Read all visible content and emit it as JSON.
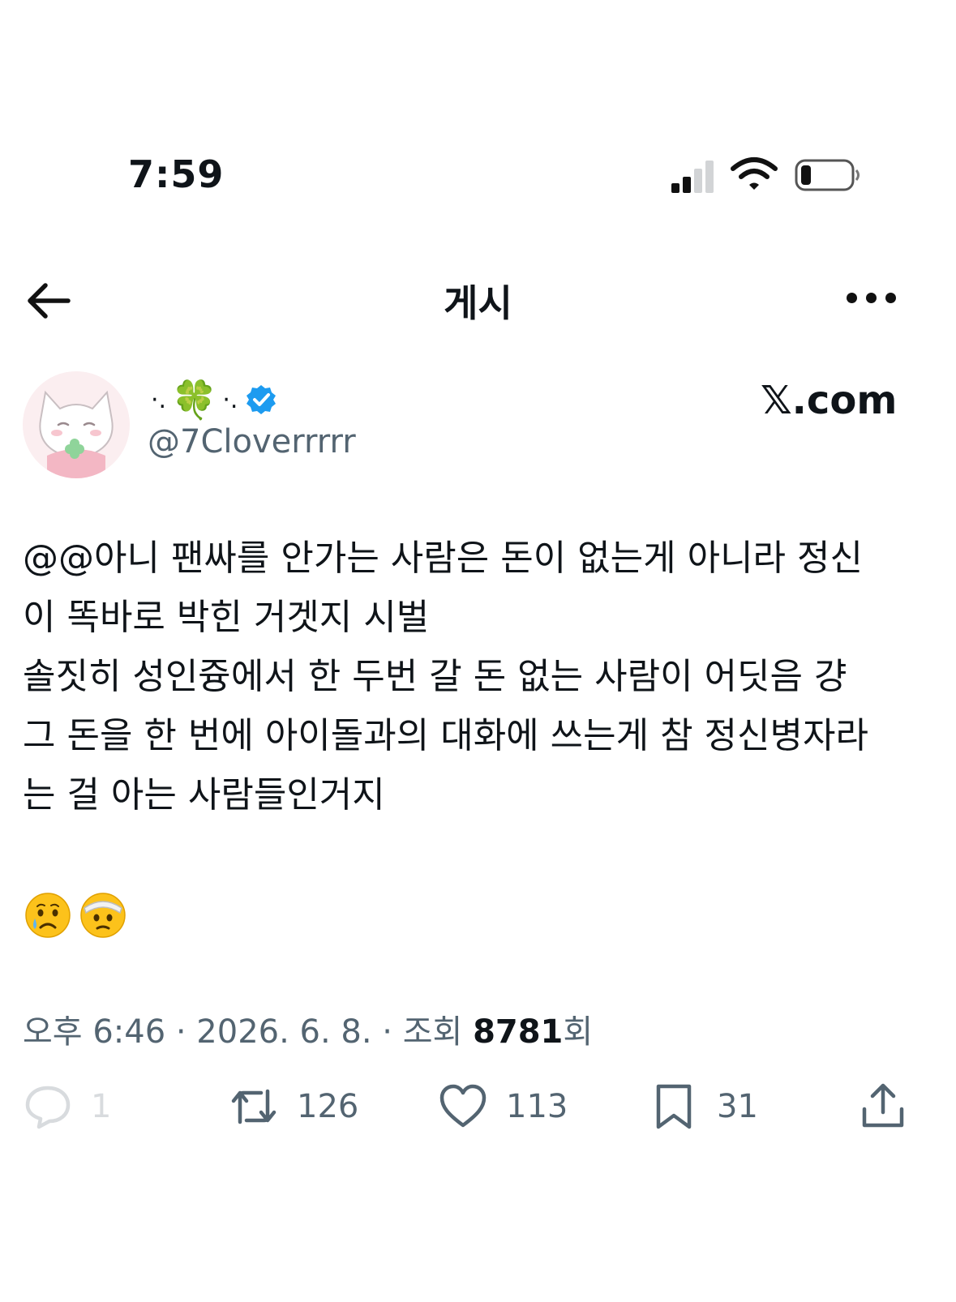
{
  "status_bar": {
    "time": "7:59",
    "icons": [
      "cellular-signal-icon",
      "wifi-icon",
      "battery-icon"
    ]
  },
  "header": {
    "title": "게시",
    "back_icon": "arrow-left-icon",
    "more_icon": "more-horizontal-icon"
  },
  "author": {
    "display_name_left": "·.",
    "display_name_emoji": "🍀",
    "display_name_right": "·.",
    "verified_icon": "verified-badge-icon",
    "handle": "@7Cloverrrrr",
    "avatar_icon": "cat-avatar-icon"
  },
  "watermark": "𝕏.com",
  "tweet": {
    "text": "@@아니 팬싸를 안가는 사람은 돈이 없는게 아니라 정신\n이 똑바로 박힌 거겟지 시벌\n솔짓히 성인즁에서 한 두번 갈 돈 없는 사람이 어딧음 걍\n그 돈을 한 번에 아이돌과의 대화에 쓰는게 참 정신병자라\n는 걸 아는 사람들인거지",
    "emojis": [
      "crying-face-icon",
      "face-with-head-bandage-icon"
    ]
  },
  "meta": {
    "time": "오후 6:46",
    "sep1": " · ",
    "date": "2026. 6. 8.",
    "sep2": " · ",
    "views_label": "조회 ",
    "views_count": "8781",
    "views_suffix": "회"
  },
  "actions": {
    "reply_count": "1",
    "repost_count": "126",
    "like_count": "113",
    "bookmark_count": "31"
  },
  "colors": {
    "text": "#0f1419",
    "secondary": "#536471",
    "verified": "#1d9bf0",
    "clover": "#2e9e3a"
  }
}
